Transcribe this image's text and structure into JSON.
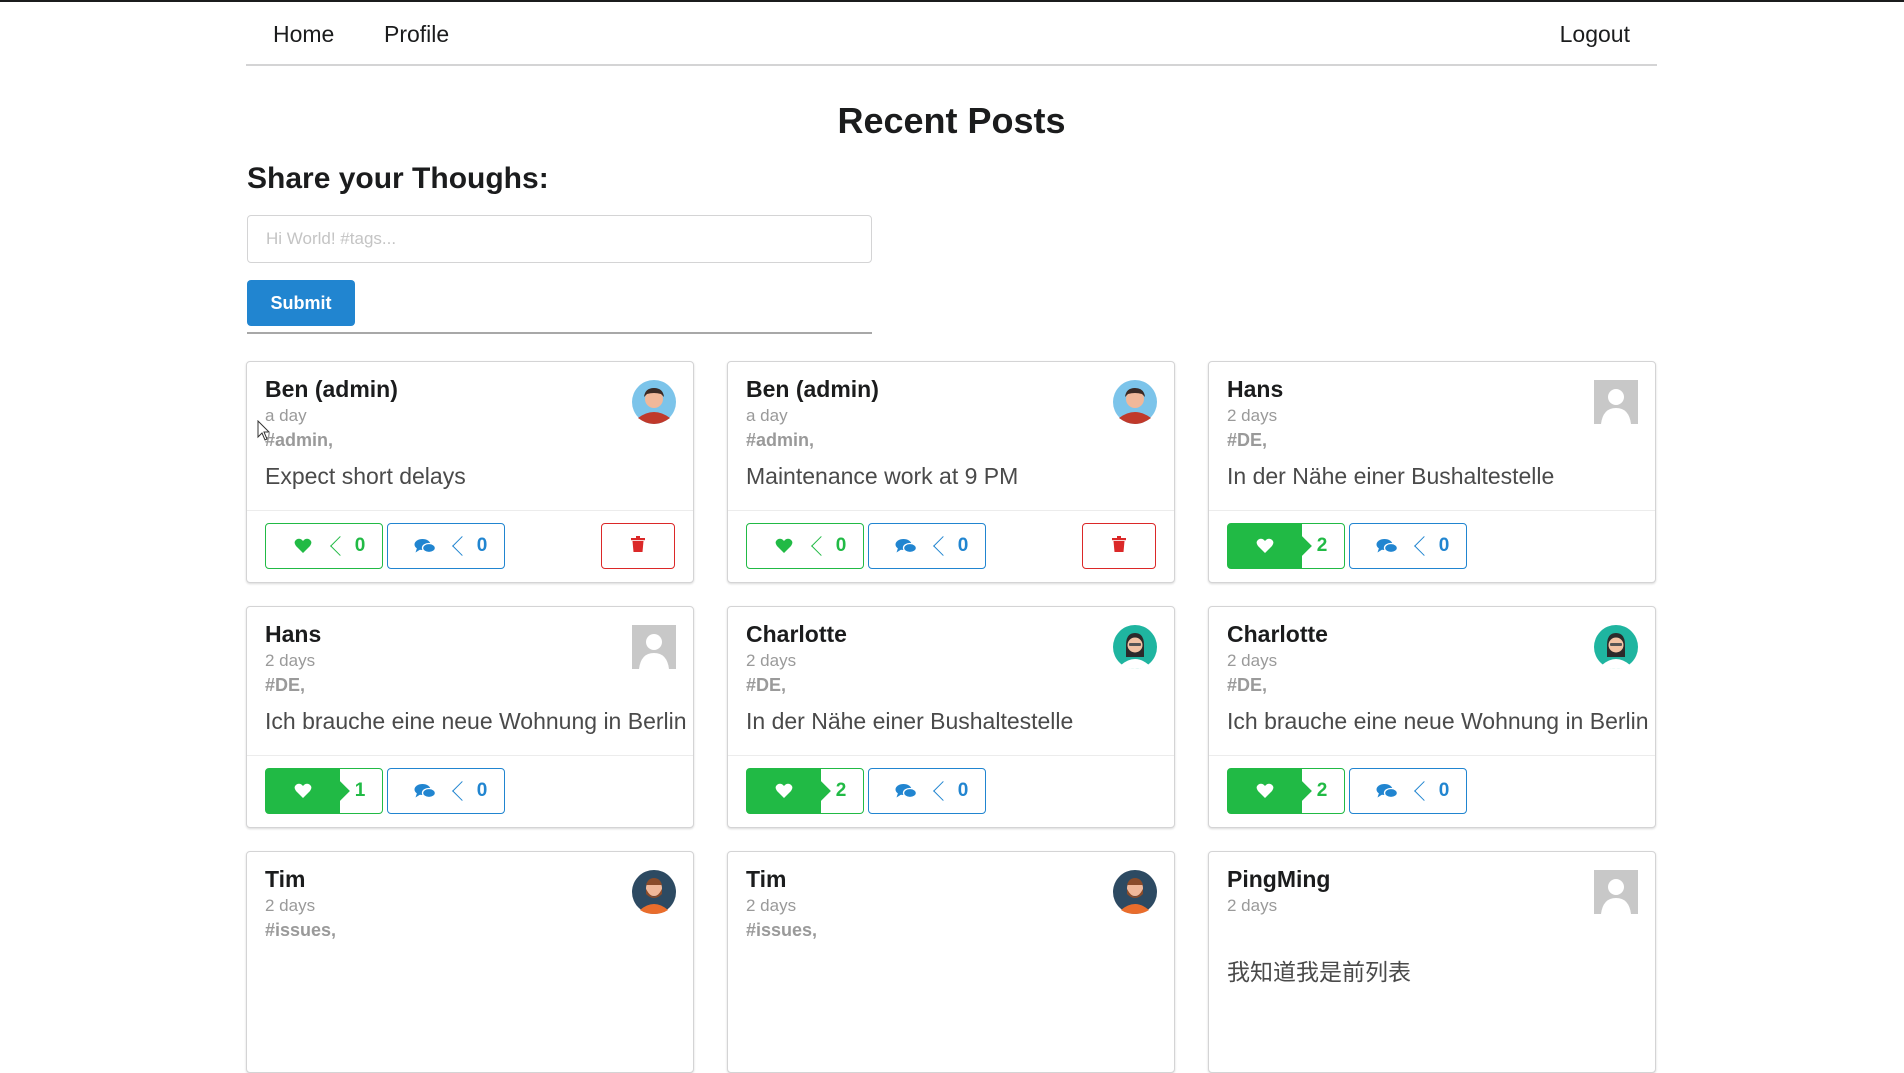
{
  "nav": {
    "home": "Home",
    "profile": "Profile",
    "logout": "Logout"
  },
  "page_title": "Recent Posts",
  "share": {
    "title": "Share your Thoughs:",
    "placeholder": "Hi World! #tags...",
    "submit": "Submit"
  },
  "colors": {
    "primary": "#2185d0",
    "like": "#21ba45",
    "delete": "#db2828"
  },
  "posts": [
    {
      "author": "Ben (admin)",
      "time": "a day",
      "tags": "#admin,",
      "content": "Expect short delays",
      "likes": "0",
      "comments": "0",
      "liked": false,
      "deletable": true,
      "avatar": "male-avatar-icon"
    },
    {
      "author": "Ben (admin)",
      "time": "a day",
      "tags": "#admin,",
      "content": "Maintenance work at 9 PM",
      "likes": "0",
      "comments": "0",
      "liked": false,
      "deletable": true,
      "avatar": "male-avatar-icon"
    },
    {
      "author": "Hans",
      "time": "2 days",
      "tags": "#DE,",
      "content": "In der Nähe einer Bushaltestelle",
      "likes": "2",
      "comments": "0",
      "liked": true,
      "deletable": false,
      "avatar": "placeholder-avatar-icon"
    },
    {
      "author": "Hans",
      "time": "2 days",
      "tags": "#DE,",
      "content": "Ich brauche eine neue Wohnung in Berlin",
      "likes": "1",
      "comments": "0",
      "liked": true,
      "deletable": false,
      "avatar": "placeholder-avatar-icon"
    },
    {
      "author": "Charlotte",
      "time": "2 days",
      "tags": "#DE,",
      "content": "In der Nähe einer Bushaltestelle",
      "likes": "2",
      "comments": "0",
      "liked": true,
      "deletable": false,
      "avatar": "female-avatar-icon"
    },
    {
      "author": "Charlotte",
      "time": "2 days",
      "tags": "#DE,",
      "content": "Ich brauche eine neue Wohnung in Berlin",
      "likes": "2",
      "comments": "0",
      "liked": true,
      "deletable": false,
      "avatar": "female-avatar-icon"
    },
    {
      "author": "Tim",
      "time": "2 days",
      "tags": "#issues,",
      "content": "",
      "likes": "",
      "comments": "",
      "liked": false,
      "deletable": false,
      "avatar": "bearded-avatar-icon"
    },
    {
      "author": "Tim",
      "time": "2 days",
      "tags": "#issues,",
      "content": "",
      "likes": "",
      "comments": "",
      "liked": false,
      "deletable": false,
      "avatar": "bearded-avatar-icon"
    },
    {
      "author": "PingMing",
      "time": "2 days",
      "tags": "",
      "content": "我知道我是前列表",
      "likes": "",
      "comments": "",
      "liked": false,
      "deletable": false,
      "avatar": "placeholder-avatar-icon"
    }
  ]
}
